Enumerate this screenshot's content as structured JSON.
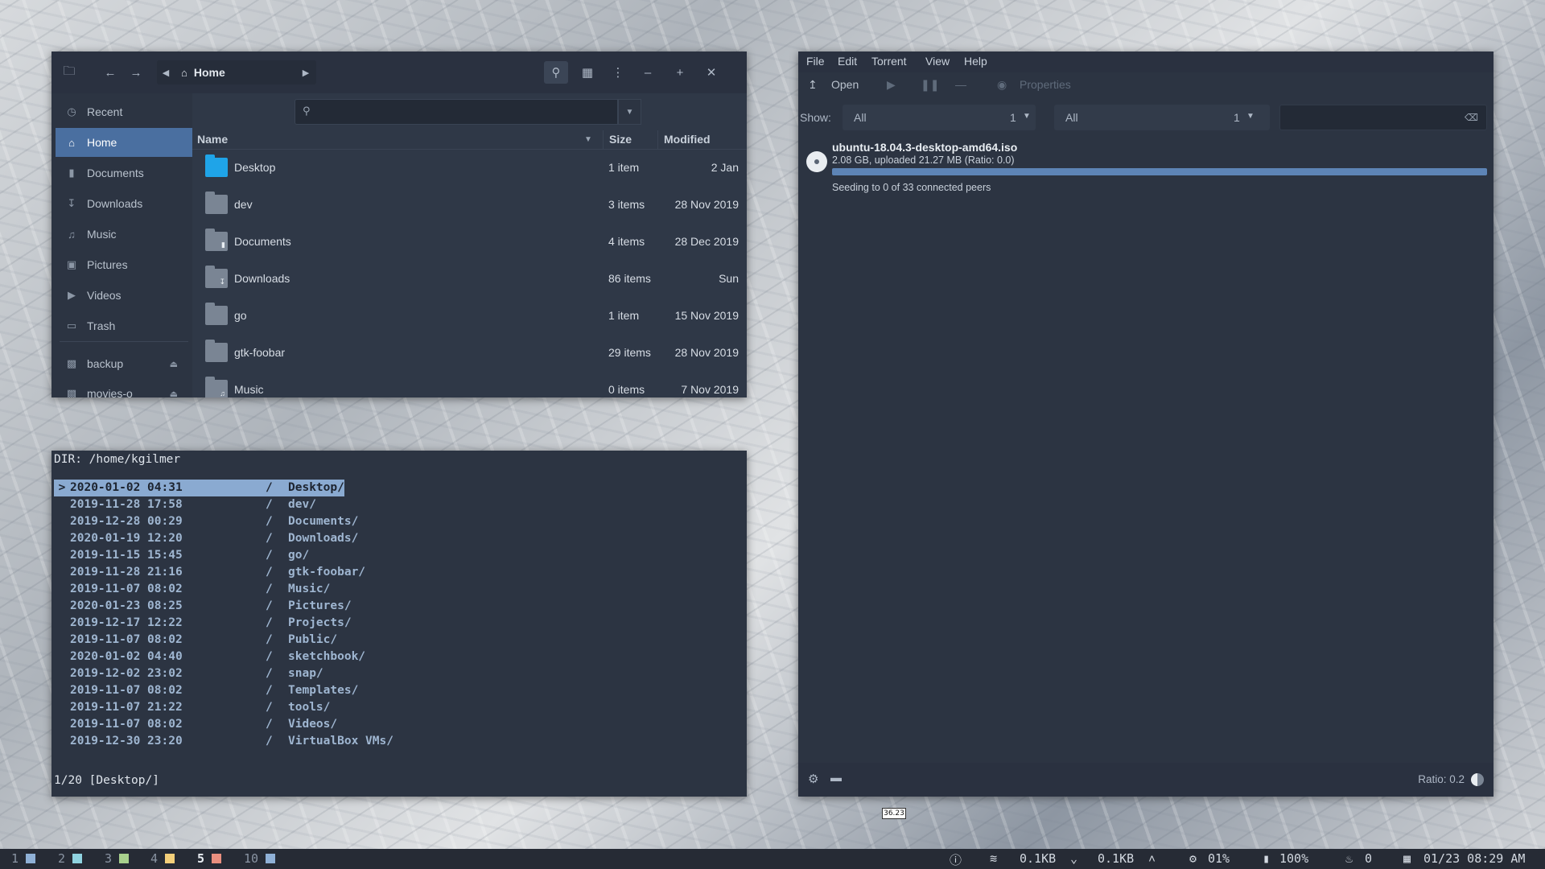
{
  "files": {
    "location": "Home",
    "search_placeholder": "",
    "sidebar": [
      {
        "label": "Recent",
        "icon": "clock-icon"
      },
      {
        "label": "Home",
        "icon": "home-icon",
        "active": true
      },
      {
        "label": "Documents",
        "icon": "document-icon"
      },
      {
        "label": "Downloads",
        "icon": "download-icon"
      },
      {
        "label": "Music",
        "icon": "music-icon"
      },
      {
        "label": "Pictures",
        "icon": "image-icon"
      },
      {
        "label": "Videos",
        "icon": "video-icon"
      },
      {
        "label": "Trash",
        "icon": "trash-icon"
      },
      {
        "label": "backup",
        "icon": "drive-icon"
      },
      {
        "label": "movies-o",
        "icon": "drive-icon"
      }
    ],
    "columns": {
      "name": "Name",
      "size": "Size",
      "modified": "Modified"
    },
    "rows": [
      {
        "name": "Desktop",
        "size": "1 item",
        "modified": "2 Jan"
      },
      {
        "name": "dev",
        "size": "3 items",
        "modified": "28 Nov 2019"
      },
      {
        "name": "Documents",
        "size": "4 items",
        "modified": "28 Dec 2019"
      },
      {
        "name": "Downloads",
        "size": "86 items",
        "modified": "Sun"
      },
      {
        "name": "go",
        "size": "1 item",
        "modified": "15 Nov 2019"
      },
      {
        "name": "gtk-foobar",
        "size": "29 items",
        "modified": "28 Nov 2019"
      },
      {
        "name": "Music",
        "size": "0 items",
        "modified": "7 Nov 2019"
      }
    ]
  },
  "terminal": {
    "dir_line": "DIR: /home/kgilmer",
    "marker": ">",
    "entries": [
      {
        "date": "2020-01-02 04:31",
        "name": "Desktop/"
      },
      {
        "date": "2019-11-28 17:58",
        "name": "dev/"
      },
      {
        "date": "2019-12-28 00:29",
        "name": "Documents/"
      },
      {
        "date": "2020-01-19 12:20",
        "name": "Downloads/"
      },
      {
        "date": "2019-11-15 15:45",
        "name": "go/"
      },
      {
        "date": "2019-11-28 21:16",
        "name": "gtk-foobar/"
      },
      {
        "date": "2019-11-07 08:02",
        "name": "Music/"
      },
      {
        "date": "2020-01-23 08:25",
        "name": "Pictures/"
      },
      {
        "date": "2019-12-17 12:22",
        "name": "Projects/"
      },
      {
        "date": "2019-11-07 08:02",
        "name": "Public/"
      },
      {
        "date": "2020-01-02 04:40",
        "name": "sketchbook/"
      },
      {
        "date": "2019-12-02 23:02",
        "name": "snap/"
      },
      {
        "date": "2019-11-07 08:02",
        "name": "Templates/"
      },
      {
        "date": "2019-11-07 21:22",
        "name": "tools/"
      },
      {
        "date": "2019-11-07 08:02",
        "name": "Videos/"
      },
      {
        "date": "2019-12-30 23:20",
        "name": "VirtualBox VMs/"
      }
    ],
    "status_line": "1/20 [Desktop/]"
  },
  "transmission": {
    "menu": [
      "File",
      "Edit",
      "Torrent",
      "View",
      "Help"
    ],
    "toolbar": {
      "open": "Open",
      "properties": "Properties"
    },
    "filter": {
      "show_label": "Show:",
      "category": "All",
      "category_count": "1",
      "tracker": "All",
      "tracker_count": "1"
    },
    "torrent": {
      "name": "ubuntu-18.04.3-desktop-amd64.iso",
      "meta": "2.08 GB, uploaded 21.27 MB (Ratio: 0.0)",
      "progress": 1.0,
      "status": "Seeding to 0 of 33 connected peers"
    },
    "ratio": "Ratio: 0.2",
    "tooltip": "36.23"
  },
  "panel": {
    "workspaces": [
      {
        "num": "1",
        "color": "#8fb0d6"
      },
      {
        "num": "2",
        "color": "#8fd3e0"
      },
      {
        "num": "3",
        "color": "#a8d08d"
      },
      {
        "num": "4",
        "color": "#f3cf7a"
      },
      {
        "num": "5",
        "color": "#e98f7f",
        "active": true
      },
      {
        "num": "10",
        "color": "#8fb0d6"
      }
    ],
    "net_down": "0.1KB",
    "net_up": "0.1KB",
    "cpu": "01%",
    "battery": "100%",
    "notifications": "0",
    "clock": "01/23 08:29 AM"
  },
  "colors": {
    "window_bg": "#2f3847",
    "accent": "#4a6fa0",
    "progress": "#5d84b6",
    "terminal_dir": "#9fb6d1"
  }
}
